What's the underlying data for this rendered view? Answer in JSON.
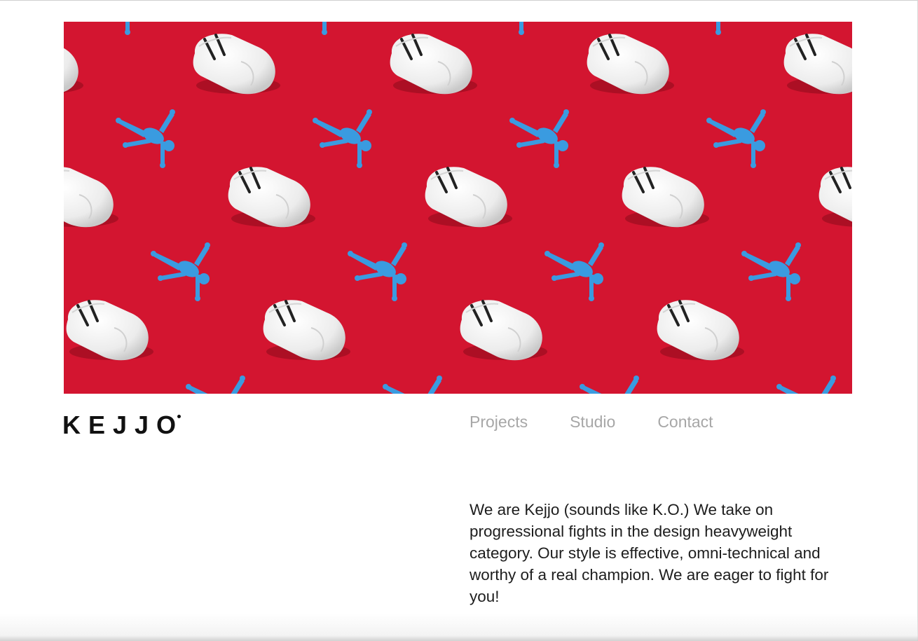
{
  "hero": {
    "image": "boxing-gloves-and-blue-fighter-figurines-pattern",
    "colors": {
      "background": "#d31530",
      "glove": "#f4f4f4",
      "figure": "#3a9be0"
    }
  },
  "brand": {
    "logo_text": "KEJJO"
  },
  "nav": {
    "items": [
      {
        "label": "Projects"
      },
      {
        "label": "Studio"
      },
      {
        "label": "Contact"
      }
    ]
  },
  "about": {
    "text": "We are Kejjo (sounds like K.O.) We take on progressional fights in the design heavyweight category. Our style is effective, omni-technical and worthy of a real champion. We are eager to fight for you!"
  }
}
